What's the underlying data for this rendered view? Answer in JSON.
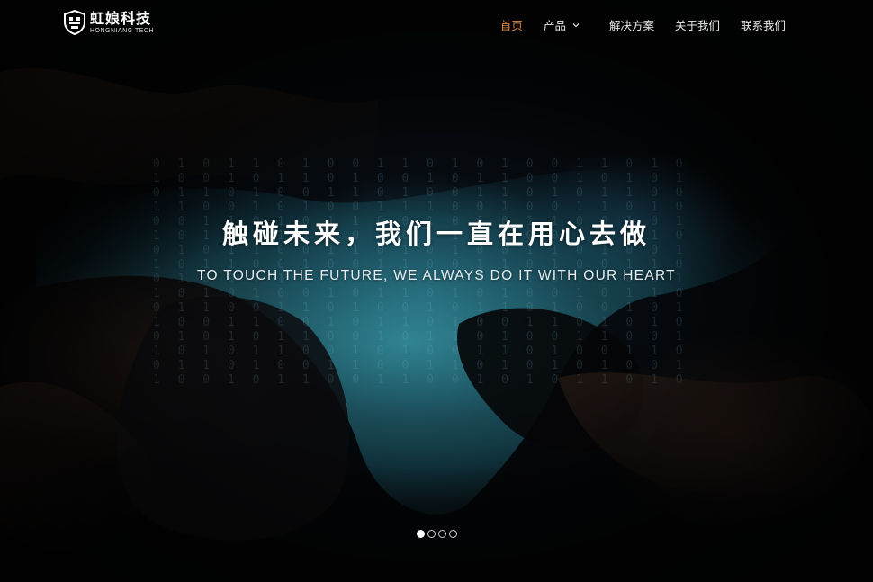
{
  "brand": {
    "name_cn": "虹娘科技",
    "name_en": "HONGNIANG TECH",
    "logo_icon": "shield-logo-icon"
  },
  "nav": {
    "items": [
      {
        "label": "首页",
        "active": true
      },
      {
        "label": "产品",
        "active": false,
        "has_dropdown": true
      },
      {
        "label": "解决方案",
        "active": false
      },
      {
        "label": "关于我们",
        "active": false
      },
      {
        "label": "联系我们",
        "active": false
      }
    ],
    "active_color": "#e08a3c",
    "default_color": "#e9e9e9",
    "dropdown_icon": "chevron-down-icon"
  },
  "hero": {
    "title": "触碰未来，我们一直在用心去做",
    "subtitle": "TO TOUCH THE FUTURE, WE ALWAYS DO IT WITH OUR HEART"
  },
  "carousel": {
    "slide_count": 4,
    "active_index": 0
  },
  "colors": {
    "background": "#040507",
    "accent": "#e08a3c",
    "teal_glow": "#2a7f8f"
  }
}
